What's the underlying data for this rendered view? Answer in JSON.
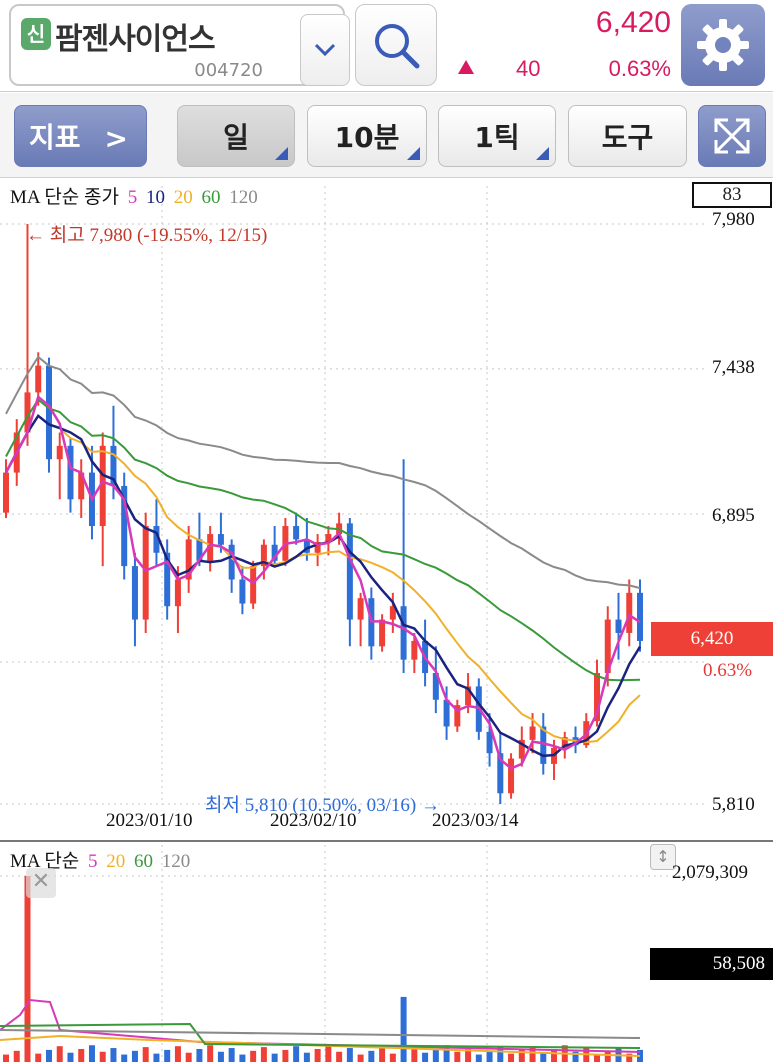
{
  "header": {
    "badge": "신",
    "stock_name": "팜젠사이언스",
    "stock_code": "004720",
    "price": "6,420",
    "change_value": "40",
    "change_pct": "0.63%",
    "icons": [
      "chevron-down-icon",
      "search-icon",
      "gear-icon"
    ]
  },
  "toolbar": {
    "indicator_label": "지표",
    "indicator_chevron": ">",
    "day_label": "일",
    "min10_label": "10분",
    "tick_label": "1틱",
    "tool_label": "도구",
    "expand_icon": "expand-arrows-icon"
  },
  "main_chart": {
    "legend_prefix": "MA 단순 종가",
    "legend_periods": [
      "5",
      "10",
      "20",
      "60",
      "120"
    ],
    "top_box": "83",
    "y_labels": [
      "7,980",
      "7,438",
      "6,895",
      "5,810"
    ],
    "current_price_tag": "6,420",
    "current_pct": "0.63%",
    "date_labels": [
      "2023/01/10",
      "2023/02/10",
      "2023/03/14"
    ],
    "high_annotation": "← 최고 7,980 (-19.55%, 12/15)",
    "low_annotation": "최저 5,810 (10.50%, 03/16) →"
  },
  "volume_chart": {
    "legend_prefix": "MA 단순",
    "legend_periods": [
      "5",
      "20",
      "60",
      "120"
    ],
    "top_label": "2,079,309",
    "current_tag": "58,508",
    "close_icon": "close-icon",
    "scroll_icon": "resize-handle-icon"
  },
  "colors": {
    "up": "#ef4037",
    "down": "#2d6fd6",
    "ma5": "#d63ab8",
    "ma10": "#1a237e",
    "ma20": "#f0b129",
    "ma60": "#3a9a3a",
    "ma120": "#8a8a8a",
    "accent": "#d81b60"
  },
  "chart_data": {
    "type": "candlestick",
    "y_range": [
      5810,
      7980
    ],
    "y_ticks": [
      7980,
      7438,
      6895,
      5810
    ],
    "x_ticks": [
      "2023/01/10",
      "2023/02/10",
      "2023/03/14"
    ],
    "high": {
      "value": 7980,
      "pct": "-19.55%",
      "date": "12/15"
    },
    "low": {
      "value": 5810,
      "pct": "10.50%",
      "date": "03/16"
    },
    "last_close": 6420,
    "candles": [
      [
        6900,
        7100,
        6880,
        7050
      ],
      [
        7050,
        7250,
        7000,
        7200
      ],
      [
        7200,
        7980,
        7150,
        7350
      ],
      [
        7350,
        7500,
        7300,
        7450
      ],
      [
        7450,
        7480,
        7050,
        7100
      ],
      [
        7100,
        7200,
        6950,
        7150
      ],
      [
        7150,
        7180,
        6900,
        6950
      ],
      [
        6950,
        7100,
        6880,
        7050
      ],
      [
        7050,
        7150,
        6800,
        6850
      ],
      [
        6850,
        7200,
        6700,
        7150
      ],
      [
        7150,
        7300,
        6950,
        7000
      ],
      [
        7000,
        7050,
        6650,
        6700
      ],
      [
        6700,
        6750,
        6400,
        6500
      ],
      [
        6500,
        6900,
        6450,
        6850
      ],
      [
        6850,
        6950,
        6700,
        6750
      ],
      [
        6750,
        6800,
        6500,
        6550
      ],
      [
        6550,
        6700,
        6450,
        6650
      ],
      [
        6650,
        6850,
        6600,
        6800
      ],
      [
        6800,
        6900,
        6700,
        6720
      ],
      [
        6720,
        6850,
        6680,
        6820
      ],
      [
        6820,
        6900,
        6750,
        6780
      ],
      [
        6780,
        6800,
        6600,
        6650
      ],
      [
        6650,
        6700,
        6520,
        6560
      ],
      [
        6560,
        6720,
        6540,
        6700
      ],
      [
        6700,
        6800,
        6650,
        6780
      ],
      [
        6780,
        6850,
        6700,
        6720
      ],
      [
        6720,
        6880,
        6700,
        6850
      ],
      [
        6850,
        6900,
        6780,
        6800
      ],
      [
        6800,
        6880,
        6720,
        6750
      ],
      [
        6750,
        6820,
        6700,
        6790
      ],
      [
        6790,
        6850,
        6740,
        6820
      ],
      [
        6820,
        6900,
        6780,
        6860
      ],
      [
        6860,
        6880,
        6400,
        6500
      ],
      [
        6500,
        6600,
        6400,
        6580
      ],
      [
        6580,
        6620,
        6350,
        6400
      ],
      [
        6400,
        6520,
        6380,
        6500
      ],
      [
        6500,
        6600,
        6450,
        6550
      ],
      [
        6550,
        7100,
        6300,
        6350
      ],
      [
        6350,
        6450,
        6300,
        6420
      ],
      [
        6420,
        6500,
        6250,
        6300
      ],
      [
        6300,
        6400,
        6150,
        6200
      ],
      [
        6200,
        6250,
        6050,
        6100
      ],
      [
        6100,
        6200,
        6080,
        6180
      ],
      [
        6180,
        6300,
        6150,
        6250
      ],
      [
        6250,
        6280,
        6050,
        6080
      ],
      [
        6080,
        6150,
        5950,
        6000
      ],
      [
        6000,
        6080,
        5810,
        5850
      ],
      [
        5850,
        6000,
        5830,
        5980
      ],
      [
        5980,
        6100,
        5950,
        6050
      ],
      [
        6050,
        6150,
        6000,
        6100
      ],
      [
        6100,
        6150,
        5920,
        5960
      ],
      [
        5960,
        6050,
        5900,
        6020
      ],
      [
        6020,
        6080,
        5980,
        6060
      ],
      [
        6060,
        6100,
        6000,
        6030
      ],
      [
        6030,
        6150,
        6020,
        6120
      ],
      [
        6120,
        6350,
        6100,
        6300
      ],
      [
        6300,
        6550,
        6250,
        6500
      ],
      [
        6500,
        6600,
        6350,
        6450
      ],
      [
        6450,
        6650,
        6400,
        6600
      ],
      [
        6600,
        6650,
        6380,
        6420
      ]
    ]
  }
}
